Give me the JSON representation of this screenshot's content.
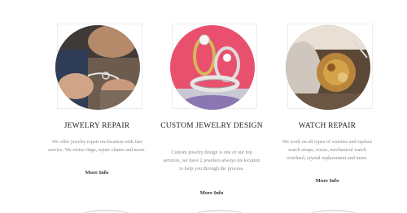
{
  "services": [
    {
      "title": "JEWELRY REPAIR",
      "description": "We offer jewelry repair on-location with fast service. We resize rings, repair chains and more.",
      "link_label": "More Info",
      "image": "jewelry-repair-photo"
    },
    {
      "title": "CUSTOM JEWELRY DESIGN",
      "description": "Custom jewelry design is one of our top services, we have 2 jewelers always on-location to help you through the process.",
      "link_label": "More Info",
      "image": "custom-jewelry-rings-photo"
    },
    {
      "title": "WATCH REPAIR",
      "description": "We work on all types of watches and replace watch straps, resize, mechanical watch overhaul, crystal replacement and more.",
      "link_label": "More Info",
      "image": "watch-repair-photo"
    }
  ],
  "colors": {
    "title": "#222222",
    "description": "#8a8a8a",
    "link": "#333333",
    "pink_backdrop": "#e8506e"
  }
}
